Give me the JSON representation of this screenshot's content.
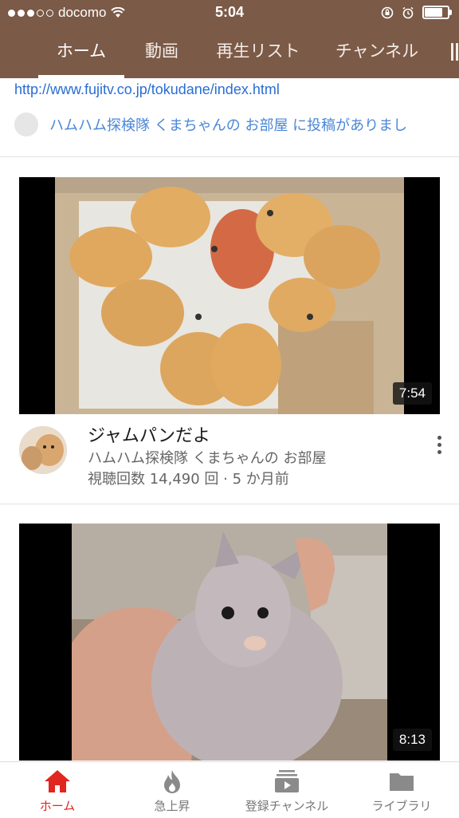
{
  "status_bar": {
    "carrier": "docomo",
    "time": "5:04",
    "signal_bars_filled": 3,
    "signal_bars_total": 5,
    "battery_level": 0.85
  },
  "tabs": [
    {
      "label": "ホーム",
      "active": true
    },
    {
      "label": "動画",
      "active": false
    },
    {
      "label": "再生リスト",
      "active": false
    },
    {
      "label": "チャンネル",
      "active": false
    }
  ],
  "top_post": {
    "link": "http://www.fujitv.co.jp/tokudane/index.html",
    "text": "ハムハム探検隊 くまちゃんの お部屋 に投稿がありまし"
  },
  "videos": [
    {
      "title": "ジャムパンだよ",
      "channel": "ハムハム探検隊 くまちゃんの お部屋",
      "stats": "視聴回数 14,490 回 · 5 か月前",
      "duration": "7:54"
    },
    {
      "duration": "8:13"
    }
  ],
  "bottom_nav": [
    {
      "label": "ホーム",
      "icon": "home-icon",
      "active": true
    },
    {
      "label": "急上昇",
      "icon": "flame-icon",
      "active": false
    },
    {
      "label": "登録チャンネル",
      "icon": "subscriptions-icon",
      "active": false
    },
    {
      "label": "ライブラリ",
      "icon": "folder-icon",
      "active": false
    }
  ],
  "colors": {
    "header": "#7b5a48",
    "active_nav": "#e0261f",
    "link": "#2a6dd3"
  }
}
